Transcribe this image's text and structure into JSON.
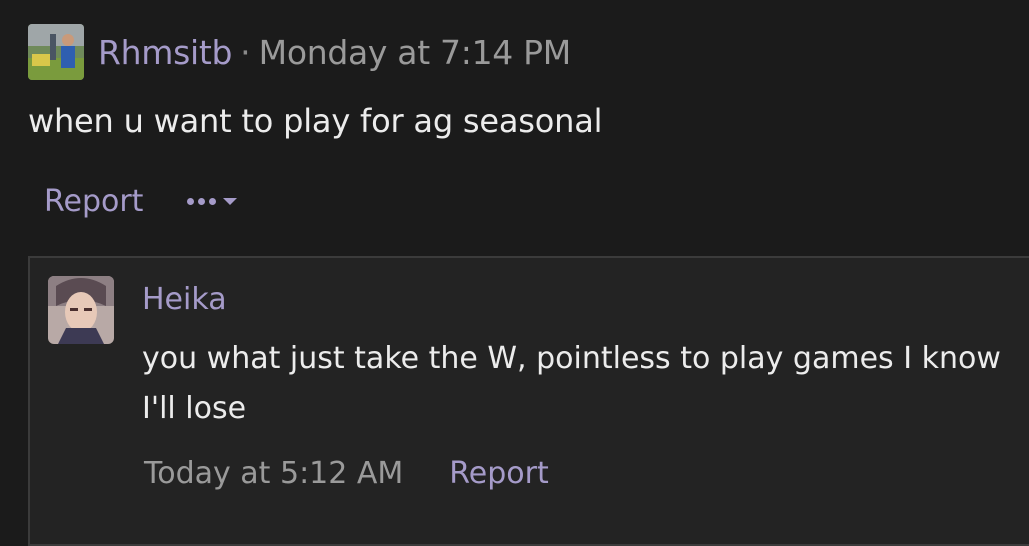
{
  "post": {
    "author": "Rhmsitb",
    "separator": "·",
    "timestamp": "Monday at 7:14 PM",
    "message": "when u want to play for ag seasonal",
    "report_label": "Report",
    "more_icon": "ellipsis-icon",
    "caret_icon": "caret-down-icon"
  },
  "quote": {
    "author": "Heika",
    "message": "you what just take the W, pointless to play games I know I'll lose",
    "timestamp": "Today at 5:12 AM",
    "report_label": "Report"
  },
  "colors": {
    "background": "#1b1b1b",
    "accent": "#a59bc9",
    "text": "#ececec",
    "muted": "#9a9a9a",
    "quote_bg": "#232323",
    "quote_border": "#3b3b3b"
  }
}
